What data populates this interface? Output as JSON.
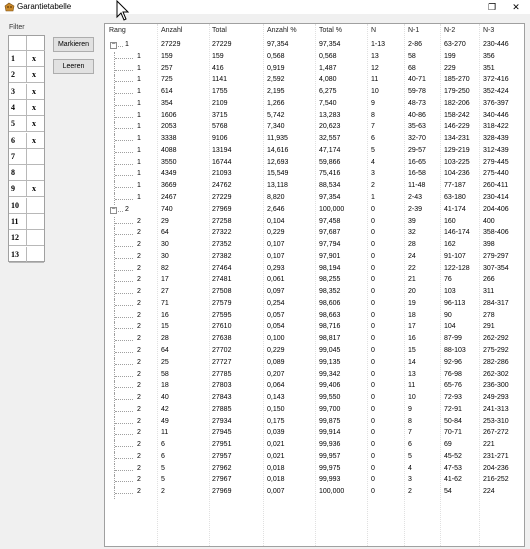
{
  "window": {
    "title": "Garantietabelle",
    "maximize_glyph": "❐",
    "close_glyph": "✕"
  },
  "filter": {
    "label": "Filter",
    "rows": [
      {
        "num": "1",
        "mark": "x"
      },
      {
        "num": "2",
        "mark": "x"
      },
      {
        "num": "3",
        "mark": "x"
      },
      {
        "num": "4",
        "mark": "x"
      },
      {
        "num": "5",
        "mark": "x"
      },
      {
        "num": "6",
        "mark": "x"
      },
      {
        "num": "7",
        "mark": ""
      },
      {
        "num": "8",
        "mark": ""
      },
      {
        "num": "9",
        "mark": "x"
      },
      {
        "num": "10",
        "mark": ""
      },
      {
        "num": "11",
        "mark": ""
      },
      {
        "num": "12",
        "mark": ""
      },
      {
        "num": "13",
        "mark": ""
      }
    ],
    "mark_button": "Markieren",
    "clear_button": "Leeren"
  },
  "table": {
    "headers": [
      "Rang",
      "Anzahl",
      "Total",
      "Anzahl %",
      "Total %",
      "N",
      "N-1",
      "N-2",
      "N-3"
    ],
    "rows": [
      {
        "level": 0,
        "expander": "−",
        "cells": [
          "1",
          "27229",
          "27229",
          "97,354",
          "97,354",
          "1-13",
          "2-86",
          "63-270",
          "230-446"
        ]
      },
      {
        "level": 1,
        "cells": [
          "1",
          "159",
          "159",
          "0,568",
          "0,568",
          "13",
          "58",
          "199",
          "356"
        ]
      },
      {
        "level": 1,
        "cells": [
          "1",
          "257",
          "416",
          "0,919",
          "1,487",
          "12",
          "68",
          "229",
          "351"
        ]
      },
      {
        "level": 1,
        "cells": [
          "1",
          "725",
          "1141",
          "2,592",
          "4,080",
          "11",
          "40-71",
          "185-270",
          "372-416"
        ]
      },
      {
        "level": 1,
        "cells": [
          "1",
          "614",
          "1755",
          "2,195",
          "6,275",
          "10",
          "59-78",
          "179-250",
          "352-424"
        ]
      },
      {
        "level": 1,
        "cells": [
          "1",
          "354",
          "2109",
          "1,266",
          "7,540",
          "9",
          "48-73",
          "182-206",
          "376-397"
        ]
      },
      {
        "level": 1,
        "cells": [
          "1",
          "1606",
          "3715",
          "5,742",
          "13,283",
          "8",
          "40-86",
          "158-242",
          "340-446"
        ]
      },
      {
        "level": 1,
        "cells": [
          "1",
          "2053",
          "5768",
          "7,340",
          "20,623",
          "7",
          "35-63",
          "146-229",
          "318-422"
        ]
      },
      {
        "level": 1,
        "cells": [
          "1",
          "3338",
          "9106",
          "11,935",
          "32,557",
          "6",
          "32-70",
          "134-231",
          "328-439"
        ]
      },
      {
        "level": 1,
        "cells": [
          "1",
          "4088",
          "13194",
          "14,616",
          "47,174",
          "5",
          "29-57",
          "129-219",
          "312-439"
        ]
      },
      {
        "level": 1,
        "cells": [
          "1",
          "3550",
          "16744",
          "12,693",
          "59,866",
          "4",
          "16-65",
          "103-225",
          "279-445"
        ]
      },
      {
        "level": 1,
        "cells": [
          "1",
          "4349",
          "21093",
          "15,549",
          "75,416",
          "3",
          "16-58",
          "104-236",
          "275-440"
        ]
      },
      {
        "level": 1,
        "cells": [
          "1",
          "3669",
          "24762",
          "13,118",
          "88,534",
          "2",
          "11-48",
          "77-187",
          "260-411"
        ]
      },
      {
        "level": 1,
        "cells": [
          "1",
          "2467",
          "27229",
          "8,820",
          "97,354",
          "1",
          "2-43",
          "63-180",
          "230-414"
        ]
      },
      {
        "level": 0,
        "expander": "−",
        "cells": [
          "2",
          "740",
          "27969",
          "2,646",
          "100,000",
          "0",
          "2-39",
          "41-174",
          "204-406"
        ]
      },
      {
        "level": 1,
        "cells": [
          "2",
          "29",
          "27258",
          "0,104",
          "97,458",
          "0",
          "39",
          "160",
          "400"
        ]
      },
      {
        "level": 1,
        "cells": [
          "2",
          "64",
          "27322",
          "0,229",
          "97,687",
          "0",
          "32",
          "146-174",
          "358-406"
        ]
      },
      {
        "level": 1,
        "cells": [
          "2",
          "30",
          "27352",
          "0,107",
          "97,794",
          "0",
          "28",
          "162",
          "398"
        ]
      },
      {
        "level": 1,
        "cells": [
          "2",
          "30",
          "27382",
          "0,107",
          "97,901",
          "0",
          "24",
          "91-107",
          "279-297"
        ]
      },
      {
        "level": 1,
        "cells": [
          "2",
          "82",
          "27464",
          "0,293",
          "98,194",
          "0",
          "22",
          "122-128",
          "307-354"
        ]
      },
      {
        "level": 1,
        "cells": [
          "2",
          "17",
          "27481",
          "0,061",
          "98,255",
          "0",
          "21",
          "76",
          "266"
        ]
      },
      {
        "level": 1,
        "cells": [
          "2",
          "27",
          "27508",
          "0,097",
          "98,352",
          "0",
          "20",
          "103",
          "311"
        ]
      },
      {
        "level": 1,
        "cells": [
          "2",
          "71",
          "27579",
          "0,254",
          "98,606",
          "0",
          "19",
          "96-113",
          "284-317"
        ]
      },
      {
        "level": 1,
        "cells": [
          "2",
          "16",
          "27595",
          "0,057",
          "98,663",
          "0",
          "18",
          "90",
          "278"
        ]
      },
      {
        "level": 1,
        "cells": [
          "2",
          "15",
          "27610",
          "0,054",
          "98,716",
          "0",
          "17",
          "104",
          "291"
        ]
      },
      {
        "level": 1,
        "cells": [
          "2",
          "28",
          "27638",
          "0,100",
          "98,817",
          "0",
          "16",
          "87-99",
          "262-292"
        ]
      },
      {
        "level": 1,
        "cells": [
          "2",
          "64",
          "27702",
          "0,229",
          "99,045",
          "0",
          "15",
          "88-103",
          "275-292"
        ]
      },
      {
        "level": 1,
        "cells": [
          "2",
          "25",
          "27727",
          "0,089",
          "99,135",
          "0",
          "14",
          "92-96",
          "282-286"
        ]
      },
      {
        "level": 1,
        "cells": [
          "2",
          "58",
          "27785",
          "0,207",
          "99,342",
          "0",
          "13",
          "76-98",
          "262-302"
        ]
      },
      {
        "level": 1,
        "cells": [
          "2",
          "18",
          "27803",
          "0,064",
          "99,406",
          "0",
          "11",
          "65-76",
          "236-300"
        ]
      },
      {
        "level": 1,
        "cells": [
          "2",
          "40",
          "27843",
          "0,143",
          "99,550",
          "0",
          "10",
          "72-93",
          "249-293"
        ]
      },
      {
        "level": 1,
        "cells": [
          "2",
          "42",
          "27885",
          "0,150",
          "99,700",
          "0",
          "9",
          "72-91",
          "241-313"
        ]
      },
      {
        "level": 1,
        "cells": [
          "2",
          "49",
          "27934",
          "0,175",
          "99,875",
          "0",
          "8",
          "50-84",
          "253-310"
        ]
      },
      {
        "level": 1,
        "cells": [
          "2",
          "11",
          "27945",
          "0,039",
          "99,914",
          "0",
          "7",
          "70-71",
          "267-272"
        ]
      },
      {
        "level": 1,
        "cells": [
          "2",
          "6",
          "27951",
          "0,021",
          "99,936",
          "0",
          "6",
          "69",
          "221"
        ]
      },
      {
        "level": 1,
        "cells": [
          "2",
          "6",
          "27957",
          "0,021",
          "99,957",
          "0",
          "5",
          "45-52",
          "231-271"
        ]
      },
      {
        "level": 1,
        "cells": [
          "2",
          "5",
          "27962",
          "0,018",
          "99,975",
          "0",
          "4",
          "47-53",
          "204-236"
        ]
      },
      {
        "level": 1,
        "cells": [
          "2",
          "5",
          "27967",
          "0,018",
          "99,993",
          "0",
          "3",
          "41-62",
          "216-252"
        ]
      },
      {
        "level": 1,
        "cells": [
          "2",
          "2",
          "27969",
          "0,007",
          "100,000",
          "0",
          "2",
          "54",
          "224"
        ]
      }
    ]
  }
}
